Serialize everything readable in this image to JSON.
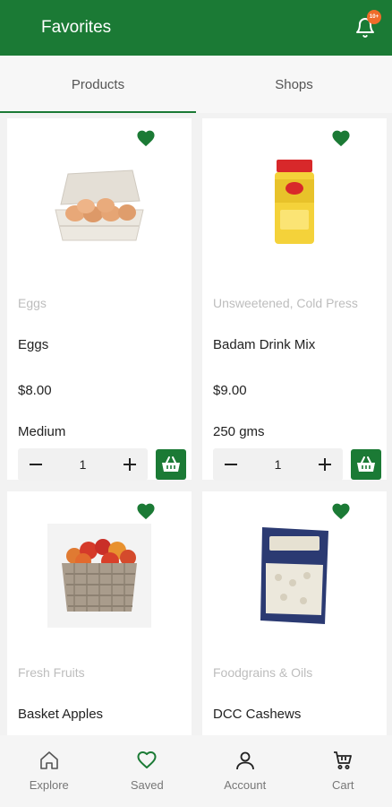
{
  "header": {
    "title": "Favorites",
    "notification_badge": "10+"
  },
  "tabs": [
    {
      "label": "Products",
      "active": true
    },
    {
      "label": "Shops",
      "active": false
    }
  ],
  "products": [
    {
      "category": "Eggs",
      "name": "Eggs",
      "price": "$8.00",
      "size": "Medium",
      "quantity": "1",
      "favorited": true
    },
    {
      "category": "Unsweetened, Cold Press",
      "name": "Badam Drink Mix",
      "price": "$9.00",
      "size": "250 gms",
      "quantity": "1",
      "favorited": true
    },
    {
      "category": "Fresh Fruits",
      "name": "Basket Apples",
      "favorited": true
    },
    {
      "category": "Foodgrains & Oils",
      "name": "DCC Cashews",
      "favorited": true
    }
  ],
  "bottom_nav": [
    {
      "label": "Explore",
      "icon": "home-icon"
    },
    {
      "label": "Saved",
      "icon": "heart-icon",
      "active": true
    },
    {
      "label": "Account",
      "icon": "user-icon"
    },
    {
      "label": "Cart",
      "icon": "cart-icon"
    }
  ],
  "colors": {
    "brand_green": "#1b7a35",
    "badge_orange": "#ef6c2b"
  }
}
